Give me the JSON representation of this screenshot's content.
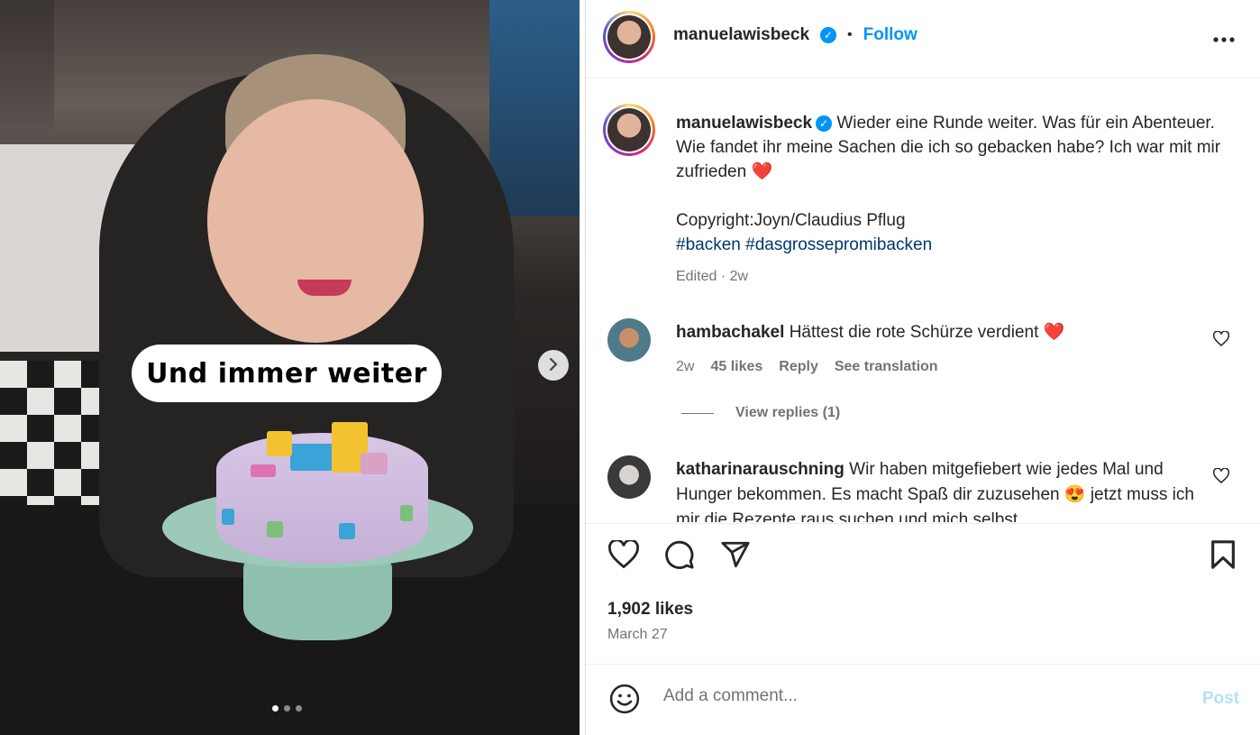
{
  "media": {
    "overlay_text": "Und immer weiter",
    "next_icon": "chevron-right-icon",
    "slide_count": 3,
    "active_slide": 1
  },
  "header": {
    "username": "manuelawisbeck",
    "verified_icon": "verified-badge-icon",
    "separator": "•",
    "follow_label": "Follow",
    "more_icon": "ellipsis-icon"
  },
  "caption": {
    "username": "manuelawisbeck",
    "text": "Wieder eine Runde weiter. Was für ein Abenteuer. Wie fandet ihr meine Sachen die ich so gebacken habe? Ich war mit mir zufrieden ❤️",
    "copyright": "Copyright:Joyn/Claudius Pflug",
    "hashtag_1": "#backen",
    "hashtag_2": "#dasgrossepromibacken",
    "meta": "Edited · 2w"
  },
  "comments": [
    {
      "username": "hambachakel",
      "text": "Hättest die rote Schürze verdient ❤️",
      "time": "2w",
      "likes": "45 likes",
      "reply": "Reply",
      "translate": "See translation",
      "view_replies": "View replies (1)"
    },
    {
      "username": "katharinarauschning",
      "text": "Wir haben mitgefiebert wie jedes Mal und Hunger bekommen. Es macht Spaß dir zuzusehen 😍 jetzt muss ich mir die Rezepte raus suchen und mich selbst"
    }
  ],
  "actions": {
    "like_icon": "heart-icon",
    "comment_icon": "comment-icon",
    "share_icon": "share-icon",
    "save_icon": "bookmark-icon",
    "likes": "1,902 likes",
    "date": "March 27"
  },
  "add_comment": {
    "emoji_icon": "emoji-icon",
    "placeholder": "Add a comment...",
    "post_label": "Post"
  },
  "colors": {
    "accent": "#0095f6",
    "hashtag": "#00376b",
    "muted": "#737373",
    "post_disabled": "#b2dffc",
    "heart_red": "#ed4956"
  }
}
